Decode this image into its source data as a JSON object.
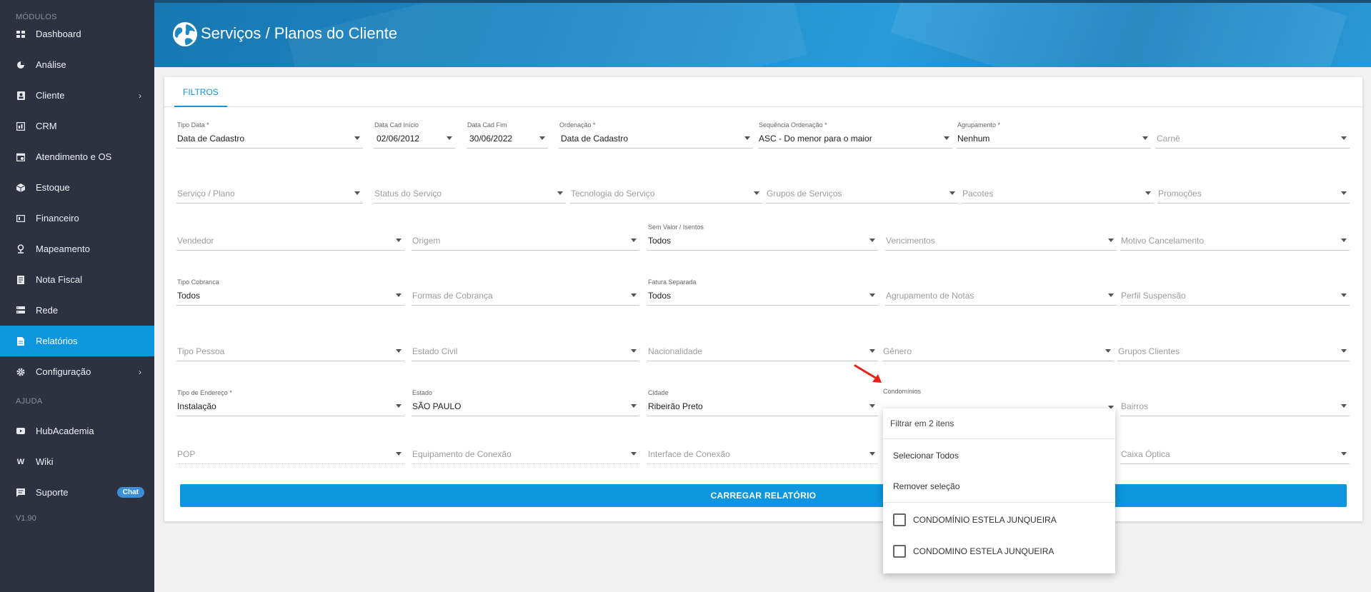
{
  "sidebar": {
    "section_modules": "MÓDULOS",
    "items": [
      {
        "label": "Dashboard",
        "icon": "dashboard-icon"
      },
      {
        "label": "Análise",
        "icon": "pie-chart-icon"
      },
      {
        "label": "Cliente",
        "icon": "client-icon"
      },
      {
        "label": "CRM",
        "icon": "crm-icon"
      },
      {
        "label": "Atendimento e OS",
        "icon": "calendar-icon"
      },
      {
        "label": "Estoque",
        "icon": "box-icon"
      },
      {
        "label": "Financeiro",
        "icon": "money-icon"
      },
      {
        "label": "Mapeamento",
        "icon": "map-pin-icon"
      },
      {
        "label": "Nota Fiscal",
        "icon": "document-icon"
      },
      {
        "label": "Rede",
        "icon": "server-icon"
      },
      {
        "label": "Relatórios",
        "icon": "report-icon"
      },
      {
        "label": "Configuração",
        "icon": "gear-icon"
      }
    ],
    "section_help": "AJUDA",
    "help_items": [
      {
        "label": "HubAcademia",
        "icon": "youtube-icon"
      },
      {
        "label": "Wiki",
        "icon": "wiki-icon"
      },
      {
        "label": "Suporte",
        "icon": "chat-icon",
        "badge": "Chat"
      }
    ],
    "version": "V1.90",
    "active_color": "#0d96de"
  },
  "header": {
    "title": "Serviços / Planos do Cliente"
  },
  "tabs": {
    "filters": "FILTROS"
  },
  "fields": {
    "tipo_data": {
      "label": "Tipo Data *",
      "value": "Data de Cadastro"
    },
    "data_cad_inicio": {
      "label": "Data Cad Início",
      "value": "02/06/2012"
    },
    "data_cad_fim": {
      "label": "Data Cad Fim",
      "value": "30/06/2022"
    },
    "ordenacao": {
      "label": "Ordenação *",
      "value": "Data de Cadastro"
    },
    "sequencia": {
      "label": "Sequência Ordenação *",
      "value": "ASC - Do menor para o maior"
    },
    "agrupamento": {
      "label": "Agrupamento *",
      "value": "Nenhum"
    },
    "carne": {
      "placeholder": "Carnê"
    },
    "servico_plano": {
      "placeholder": "Serviço / Plano"
    },
    "status_servico": {
      "placeholder": "Status do Serviço"
    },
    "tecnologia": {
      "placeholder": "Tecnologia do Serviço"
    },
    "grupos_servicos": {
      "placeholder": "Grupos de Serviços"
    },
    "pacotes": {
      "placeholder": "Pacotes"
    },
    "promocoes": {
      "placeholder": "Promoções"
    },
    "vendedor": {
      "placeholder": "Vendedor"
    },
    "origem": {
      "placeholder": "Origem"
    },
    "sem_valor": {
      "label": "Sem Valor / Isentos",
      "value": "Todos"
    },
    "vencimentos": {
      "placeholder": "Vencimentos"
    },
    "motivo_cancel": {
      "placeholder": "Motivo Cancelamento"
    },
    "tipo_cobranca": {
      "label": "Tipo Cobranca",
      "value": "Todos"
    },
    "formas_cobranca": {
      "placeholder": "Formas de Cobrança"
    },
    "fatura_separada": {
      "label": "Fatura Separada",
      "value": "Todos"
    },
    "agrup_notas": {
      "placeholder": "Agrupamento de Notas"
    },
    "perfil_suspensao": {
      "placeholder": "Perfil Suspensão"
    },
    "tipo_pessoa": {
      "placeholder": "Tipo Pessoa"
    },
    "estado_civil": {
      "placeholder": "Estado Civil"
    },
    "nacionalidade": {
      "placeholder": "Nacionalidade"
    },
    "genero": {
      "placeholder": "Gênero"
    },
    "grupos_clientes": {
      "placeholder": "Grupos Clientes"
    },
    "tipo_endereco": {
      "label": "Tipo de Endereço *",
      "value": "Instalação"
    },
    "estado": {
      "label": "Estado",
      "value": "SÃO PAULO"
    },
    "cidade": {
      "label": "Cidade",
      "value": "Ribeirão Preto"
    },
    "condominios": {
      "label": "Condomínios"
    },
    "bairros": {
      "placeholder": "Bairros"
    },
    "pop": {
      "placeholder": "POP"
    },
    "equip_conexao": {
      "placeholder": "Equipamento de Conexão"
    },
    "interface_conexao": {
      "placeholder": "Interface de Conexão"
    },
    "caixa_optica": {
      "placeholder": "Caixa Óptica"
    }
  },
  "buttons": {
    "load_report": "CARREGAR RELATÓRIO"
  },
  "dropdown": {
    "filter_placeholder": "Filtrar em 2 itens",
    "select_all": "Selecionar Todos",
    "remove_selection": "Remover seleção",
    "options": [
      "CONDOMÍNIO ESTELA JUNQUEIRA",
      "CONDOMINO ESTELA JUNQUEIRA"
    ]
  }
}
